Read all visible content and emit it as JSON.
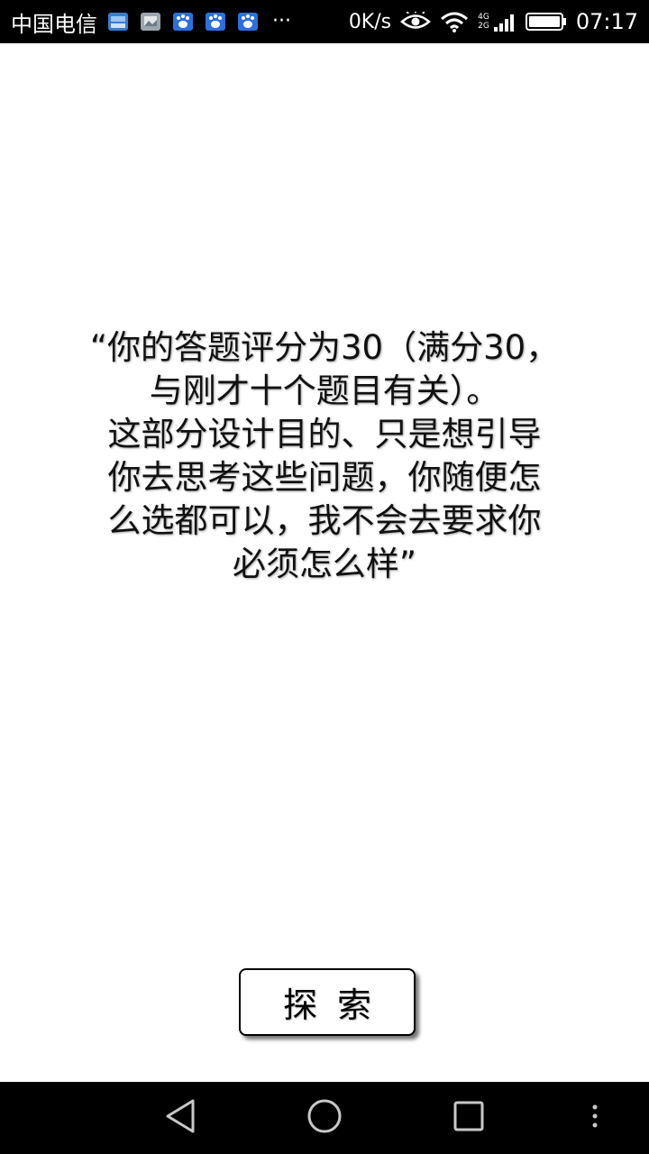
{
  "status_bar": {
    "carrier": "中国电信",
    "more": "···",
    "net_speed": "0K/s",
    "net_type_top": "4G",
    "net_type_bottom": "2G",
    "time": "07:17"
  },
  "main": {
    "quote_lines": [
      "“你的答题评分为30（满分30，",
      "与刚才十个题目有关）。",
      "这部分设计目的、只是想引导",
      "你去思考这些问题，你随便怎",
      "么选都可以，我不会去要求你",
      "必须怎么样”"
    ],
    "button_label": "探索"
  },
  "icons": {
    "notif_1": "message-app-icon",
    "notif_2": "gallery-app-icon",
    "notif_3": "baidu-paw-icon",
    "notif_4": "baidu-paw-icon",
    "notif_5": "baidu-paw-icon",
    "eye": "eye-comfort-icon",
    "wifi": "wifi-icon",
    "signal": "cell-signal-icon",
    "battery": "battery-full-icon",
    "nav_back": "back-triangle-icon",
    "nav_home": "home-circle-icon",
    "nav_recent": "recents-square-icon",
    "nav_menu": "menu-dots-icon"
  },
  "colors": {
    "status_bar_bg": "#000000",
    "nav_bar_bg": "#000000",
    "page_bg": "#ffffff",
    "text": "#111111"
  }
}
